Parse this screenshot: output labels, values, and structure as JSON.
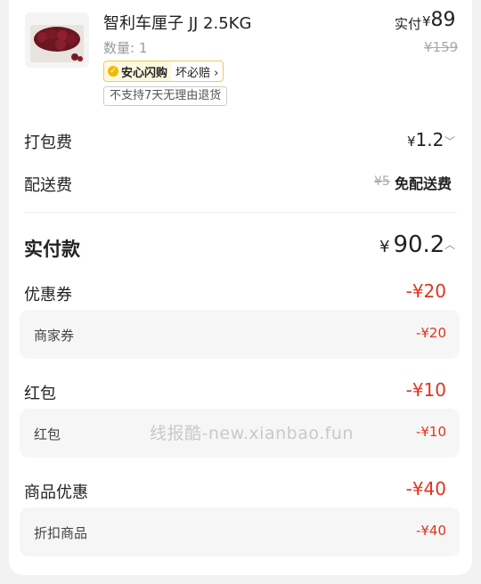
{
  "product": {
    "name": "智利车厘子 JJ 2.5KG",
    "quantity": "数量: 1",
    "paid_label": "实付",
    "paid_currency": "¥",
    "paid_amount": "89",
    "original_price": "¥159",
    "guarantee_tag": "安心闪购",
    "guarantee_link": "坏必赔",
    "return_policy": "不支持7天无理由退货"
  },
  "fees": {
    "packing_label": "打包费",
    "packing_currency": "¥",
    "packing_value": "1.2",
    "delivery_label": "配送费",
    "delivery_original": "¥5",
    "delivery_value": "免配送费"
  },
  "total": {
    "label": "实付款",
    "currency": "¥",
    "value": "90.2"
  },
  "discounts": [
    {
      "label": "优惠券",
      "value": "-¥20",
      "sub_label": "商家券",
      "sub_value": "-¥20"
    },
    {
      "label": "红包",
      "value": "-¥10",
      "sub_label": "红包",
      "sub_value": "-¥10"
    },
    {
      "label": "商品优惠",
      "value": "-¥40",
      "sub_label": "折扣商品",
      "sub_value": "-¥40"
    }
  ],
  "watermark": "线报酷-new.xianbao.fun",
  "colors": {
    "discount_red": "#e1341e",
    "guarantee_yellow": "#f5b800"
  }
}
